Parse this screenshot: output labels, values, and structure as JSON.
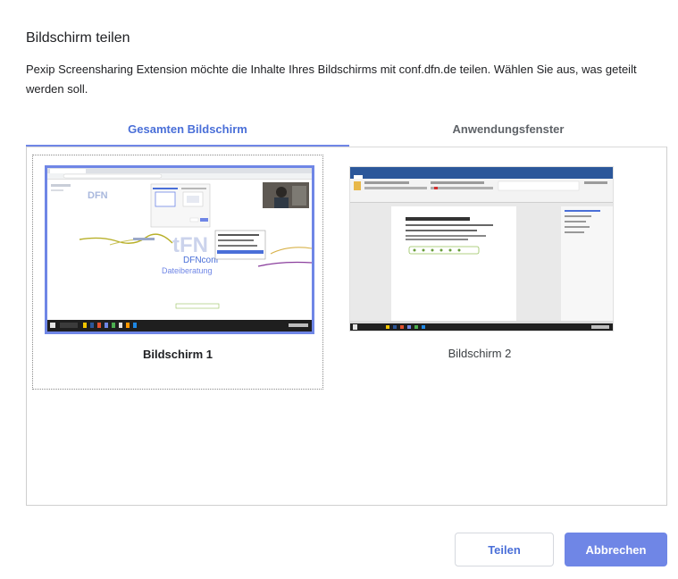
{
  "dialog": {
    "title": "Bildschirm teilen",
    "description": "Pexip Screensharing Extension möchte die Inhalte Ihres Bildschirms mit conf.dfn.de teilen. Wählen Sie aus, was geteilt werden soll."
  },
  "tabs": [
    {
      "label": "Gesamten Bildschirm",
      "selected": true
    },
    {
      "label": "Anwendungsfenster",
      "selected": false
    }
  ],
  "screens": [
    {
      "label": "Bildschirm 1",
      "selected": true
    },
    {
      "label": "Bildschirm 2",
      "selected": false
    }
  ],
  "preview1": {
    "logo_text": "DFN",
    "center_text_line1": "tFN",
    "center_text_line2": "DFNconf",
    "center_text_line3": "Dateiberatung"
  },
  "buttons": {
    "share": "Teilen",
    "cancel": "Abbrechen"
  },
  "colors": {
    "accent": "#6f86e6",
    "accent_text": "#4a6fd8",
    "word_blue": "#2b579a",
    "taskbar": "#1f1f1f"
  }
}
